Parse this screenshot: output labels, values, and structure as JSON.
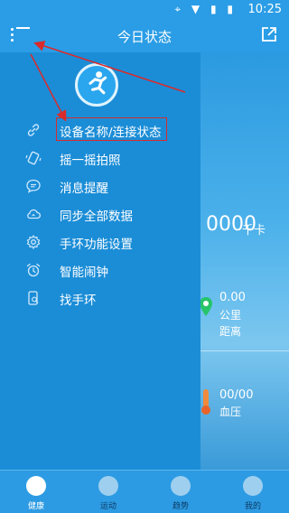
{
  "status_bar": {
    "time": "10:25",
    "icons": "⌖ ▼ ▮ ▮"
  },
  "app_bar": {
    "title": "今日状态"
  },
  "drawer": {
    "items": [
      {
        "label": "设备名称/连接状态",
        "icon": "link-icon"
      },
      {
        "label": "摇一摇拍照",
        "icon": "shake-phone-icon"
      },
      {
        "label": "消息提醒",
        "icon": "message-bubble-icon"
      },
      {
        "label": "同步全部数据",
        "icon": "cloud-sync-icon"
      },
      {
        "label": "手环功能设置",
        "icon": "gear-icon"
      },
      {
        "label": "智能闹钟",
        "icon": "alarm-clock-icon"
      },
      {
        "label": "找手环",
        "icon": "find-band-icon"
      }
    ]
  },
  "main": {
    "calories_value": "0000",
    "calories_unit": "千卡",
    "distance_value": "0.00",
    "distance_unit": "公里",
    "distance_label": "距离",
    "bp_value": "00/00",
    "bp_label": "血压"
  },
  "bottom_nav": {
    "items": [
      {
        "label": "健康",
        "active": true
      },
      {
        "label": "运动",
        "active": false
      },
      {
        "label": "趋势",
        "active": false
      },
      {
        "label": "我的",
        "active": false
      }
    ]
  },
  "colors": {
    "accent": "#1b8dd7",
    "highlight": "#d92b2b"
  }
}
